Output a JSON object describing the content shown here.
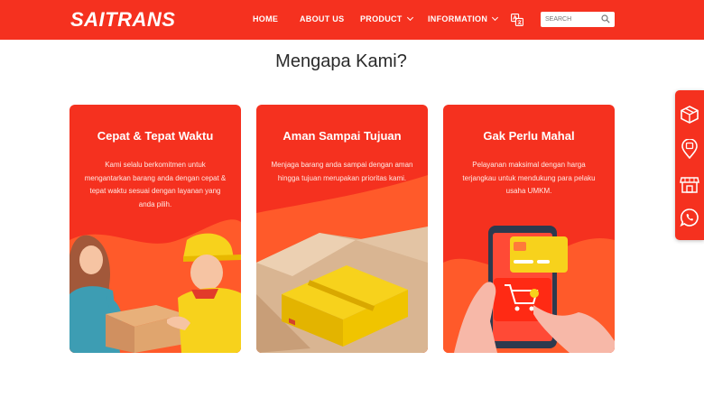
{
  "brand": {
    "logo_text": "SAITRANS"
  },
  "nav": {
    "home": "HOME",
    "about": "ABOUT US",
    "product": "PRODUCT",
    "information": "INFORMATION"
  },
  "search": {
    "placeholder": "SEARCH"
  },
  "section": {
    "title": "Mengapa Kami?"
  },
  "cards": [
    {
      "title": "Cepat & Tepat Waktu",
      "text": "Kami selalu berkomitmen untuk mengantarkan barang anda dengan cepat & tepat waktu sesuai dengan layanan yang anda pilih."
    },
    {
      "title": "Aman Sampai Tujuan",
      "text": "Menjaga barang anda sampai dengan aman hingga tujuan merupakan prioritas kami."
    },
    {
      "title": "Gak Perlu Mahal",
      "text": "Pelayanan maksimal dengan harga terjangkau untuk mendukung para pelaku usaha UMKM."
    }
  ],
  "colors": {
    "brand_red": "#f5311f",
    "brand_yellow": "#f7d21c",
    "title_text": "#2b2b2b"
  },
  "sidebar_icons": [
    "package-icon",
    "location-icon",
    "store-icon",
    "whatsapp-icon"
  ]
}
